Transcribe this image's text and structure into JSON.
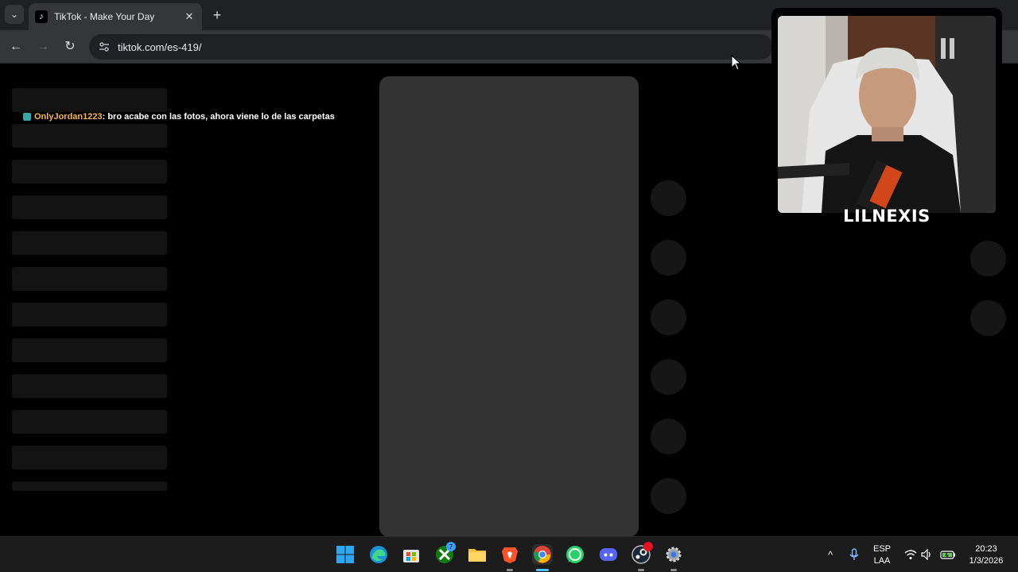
{
  "browser": {
    "tab_title": "TikTok - Make Your Day",
    "tab_close": "✕",
    "new_tab": "+",
    "tab_dropdown": "⌄",
    "url": "tiktok.com/es-419/",
    "back": "←",
    "forward": "→",
    "reload": "↻"
  },
  "chat": {
    "user": "OnlyJordan1223",
    "message": " : bro acabe con las fotos, ahora viene lo de las carpetas"
  },
  "webcam": {
    "name": "LILNEXIS"
  },
  "taskbar": {
    "apps": [
      {
        "name": "windows-start-icon"
      },
      {
        "name": "edge-icon"
      },
      {
        "name": "store-icon"
      },
      {
        "name": "xbox-icon",
        "badge": "7"
      },
      {
        "name": "file-explorer-icon"
      },
      {
        "name": "brave-icon"
      },
      {
        "name": "chrome-icon"
      },
      {
        "name": "whatsapp-icon"
      },
      {
        "name": "discord-icon"
      },
      {
        "name": "steam-icon"
      },
      {
        "name": "settings-icon"
      }
    ],
    "tray": {
      "chevron": "^",
      "lang_1": "ESP",
      "lang_2": "LAA",
      "time": "20:23",
      "date": "1/3/2026"
    }
  },
  "colors": {
    "chat_user": "#f5b74a",
    "chrome_tab": "#35363a",
    "tabbar": "#202124",
    "video_placeholder": "#333334"
  }
}
